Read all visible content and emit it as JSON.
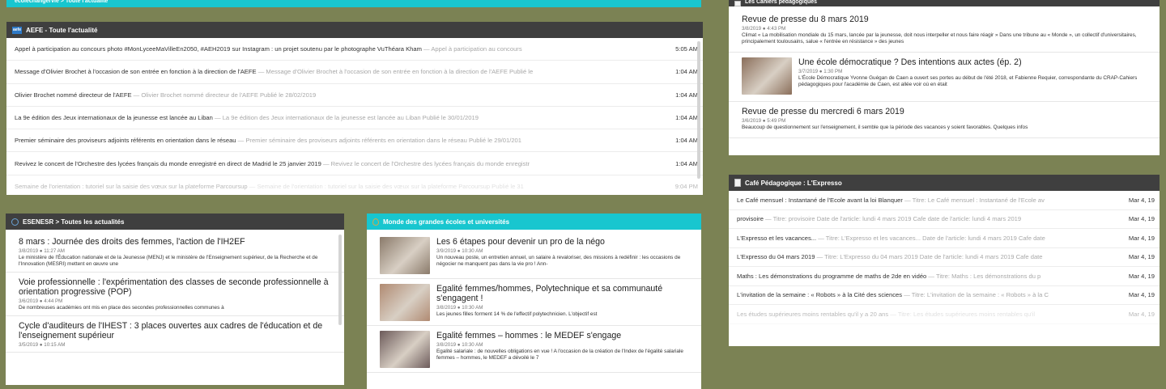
{
  "top_strip": {
    "label": "ecolechangervie > Toute l'actualité"
  },
  "aefe": {
    "title": "AEFE - Toute l'actualité",
    "icon": "aefe-logo-icon",
    "items": [
      {
        "title": "Appel à participation au concours photo #MonLyceeMaVilleEn2050, #AEH2019 sur Instagram : un projet soutenu par le photographe VuThéara Kham",
        "desc": "— Appel à participation au concours",
        "time": "5:05 AM"
      },
      {
        "title": "Message d'Olivier Brochet à l'occasion de son entrée en fonction à la direction de l'AEFE",
        "desc": "— Message d'Olivier Brochet à l'occasion de son entrée en fonction à la direction de l'AEFE Publié le",
        "time": "1:04 AM"
      },
      {
        "title": "Olivier Brochet nommé directeur de l'AEFE",
        "desc": "— Olivier Brochet nommé directeur de l'AEFE Publié le 28/02/2019",
        "time": "1:04 AM"
      },
      {
        "title": "La 9e édition des Jeux internationaux de la jeunesse est lancée au Liban",
        "desc": "— La 9e édition des Jeux internationaux de la jeunesse est lancée au Liban Publié le 30/01/2019",
        "time": "1:04 AM"
      },
      {
        "title": "Premier séminaire des proviseurs adjoints référents en orientation dans le réseau",
        "desc": "— Premier séminaire des proviseurs adjoints référents en orientation dans le réseau Publié le 29/01/201",
        "time": "1:04 AM"
      },
      {
        "title": "Revivez le concert de l'Orchestre des lycées français du monde enregistré en direct de Madrid le 25 janvier 2019",
        "desc": "— Revivez le concert de l'Orchestre des lycées français du monde enregistr",
        "time": "1:04 AM"
      },
      {
        "title": "Semaine de l'orientation : tutoriel sur la saisie des vœux sur la plateforme Parcoursup",
        "desc": "— Semaine de l'orientation : tutoriel sur la saisie des vœux sur la plateforme Parcoursup Publié le 31",
        "time": "9:04 PM"
      }
    ]
  },
  "esenesr": {
    "title": "ESENESR > Toutes les actualités",
    "icon": "globe-icon",
    "articles": [
      {
        "title": "8 mars : Journée des droits des femmes, l'action de l'IH2EF",
        "meta": "3/8/2019 ● 11:27 AM",
        "desc": "Le ministère de l'Éducation nationale et de la Jeunesse (MENJ) et le ministère de l'Enseignement supérieur, de la Recherche et de l'Innovation (MESRI) mettent en œuvre une"
      },
      {
        "title": "Voie professionnelle : l'expérimentation des classes de seconde professionnelle à orientation progressive (POP)",
        "meta": "3/6/2019 ● 4:44 PM",
        "desc": "De nombreuses académies ont mis en place des secondes professionnelles communes à"
      },
      {
        "title": "Cycle d'auditeurs de l'IHEST : 3 places ouvertes aux cadres de l'éducation et de l'enseignement supérieur",
        "meta": "3/5/2019 ● 10:15 AM",
        "desc": ""
      }
    ]
  },
  "grandes_ecoles": {
    "title": "Monde des grandes écoles et universités",
    "icon": "drop-icon",
    "articles": [
      {
        "title": "Les 6 étapes pour devenir un pro de la négo",
        "meta": "3/9/2019 ● 10:30 AM",
        "desc": "Un nouveau poste, un entretien annuel, un salaire à revaloriser, des missions à redéfinir : les occasions de négocier ne manquent pas dans la vie pro ! Ann-",
        "thumb": "#8a7a6a"
      },
      {
        "title": "Egalité femmes/hommes, Polytechnique et sa communauté s'engagent !",
        "meta": "3/8/2019 ● 10:30 AM",
        "desc": "Les jeunes filles forment 14 % de l'effectif polytechnicien. L'objectif est",
        "thumb": "#b08a72"
      },
      {
        "title": "Egalité femmes – hommes : le MEDEF s'engage",
        "meta": "3/8/2019 ● 10:30 AM",
        "desc": "Egalité salariale : de nouvelles obligations en vue ! A l'occasion de la création de l'Index de l'égalité salariale femmes – hommes, le MEDEF a dévoilé le 7",
        "thumb": "#6c5a5a"
      }
    ]
  },
  "cahiers": {
    "title": "Les Cahiers pédagogiques",
    "icon": "document-icon",
    "articles": [
      {
        "title": "Revue de presse du 8 mars 2019",
        "meta": "3/8/2019 ● 4:43 PM",
        "desc": "Climat « La mobilisation mondiale du 15 mars, lancée par la jeunesse, doit nous interpeller et nous faire réagir » Dans une tribune au « Monde », un collectif d'universitaires, principalement toulousains, salue « l'entrée en résistance » des jeunes"
      },
      {
        "title": "Une école démocratique ? Des intentions aux actes (ép. 2)",
        "meta": "3/7/2019 ● 1:30 PM",
        "desc": "L'École Démocratique Yvonne Guégan de Caen a ouvert ses portes au début de l'été 2018, et Fabienne Requier, correspondante du CRAP-Cahiers pédagogiques pour l'académie de Caen, est allée voir où en était",
        "thumb": "#8a6e5a"
      },
      {
        "title": "Revue de presse du mercredi 6 mars 2019",
        "meta": "3/6/2019 ● 5:49 PM",
        "desc": "Beaucoup de questionnement sur l'enseignement, il semble que la période des vacances y soient favorables. Quelques infos"
      }
    ]
  },
  "expresso": {
    "title": "Café Pédagogique : L'Expresso",
    "icon": "document-icon",
    "items": [
      {
        "title": "Le Café mensuel : Instantané de l'Ecole avant la loi Blanquer",
        "desc": "— Titre: Le Café mensuel : Instantané de l'Ecole av",
        "time": "Mar 4, 19"
      },
      {
        "title": "provisoire",
        "desc": "— Titre: provisoire Date de l'article: lundi 4 mars 2019 Cafe date de l'article: lundi 4 mars 2019",
        "time": "Mar 4, 19"
      },
      {
        "title": "L'Expresso et les vacances...",
        "desc": "— Titre: L'Expresso et les vacances... Date de l'article: lundi 4 mars 2019 Cafe date",
        "time": "Mar 4, 19"
      },
      {
        "title": "L'Expresso du 04 mars 2019",
        "desc": "— Titre: L'Expresso du 04 mars 2019 Date de l'article: lundi 4 mars 2019 Cafe date",
        "time": "Mar 4, 19"
      },
      {
        "title": "Maths : Les démonstrations du programme de maths de 2de en vidéo",
        "desc": "— Titre: Maths : Les démonstrations du p",
        "time": "Mar 4, 19"
      },
      {
        "title": "L'invitation de la semaine : « Robots » à la Cité des sciences",
        "desc": "— Titre: L'invitation de la semaine : « Robots » à la C",
        "time": "Mar 4, 19"
      },
      {
        "title": "Les études supérieures moins rentables qu'il y a 20 ans",
        "desc": "— Titre: Les études supérieures moins rentables qu'il",
        "time": "Mar 4, 19"
      }
    ]
  },
  "colors": {
    "background": "#7b8254",
    "header_dark": "#3f3f3f",
    "header_teal": "#18c6cf"
  }
}
